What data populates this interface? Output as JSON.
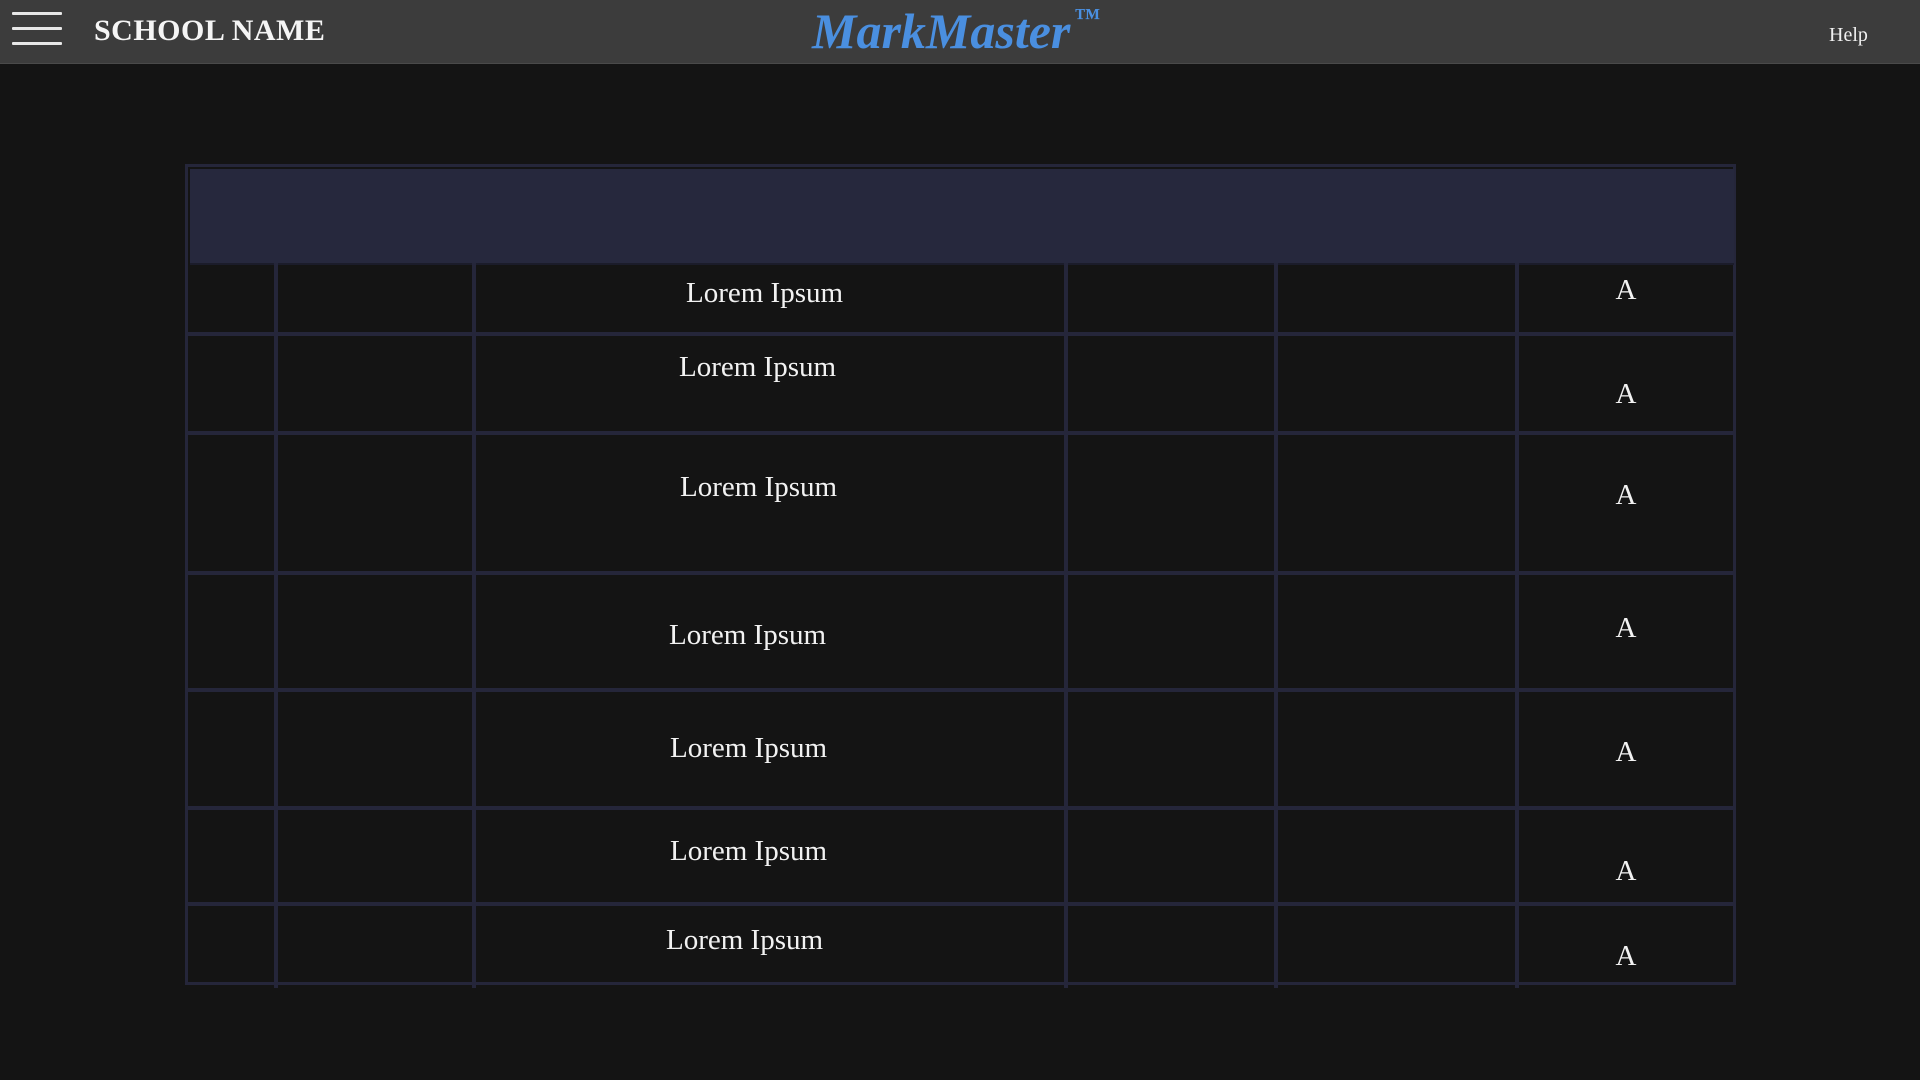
{
  "header": {
    "school_name": "SCHOOL NAME",
    "brand": "MarkMaster",
    "trademark": "™",
    "help_label": "Help"
  },
  "grid": {
    "rows": [
      {
        "text": "Lorem Ipsum",
        "grade": "A"
      },
      {
        "text": "Lorem Ipsum",
        "grade": "A"
      },
      {
        "text": "Lorem Ipsum",
        "grade": "A"
      },
      {
        "text": "Lorem Ipsum",
        "grade": "A"
      },
      {
        "text": "Lorem Ipsum",
        "grade": "A"
      },
      {
        "text": "Lorem Ipsum",
        "grade": "A"
      },
      {
        "text": "Lorem Ipsum",
        "grade": "A"
      }
    ]
  },
  "colors": {
    "background": "#141414",
    "topbar": "#3c3c3c",
    "brand": "#4a8fe0",
    "grid_line": "#25263a",
    "grid_header": "#26283d"
  }
}
